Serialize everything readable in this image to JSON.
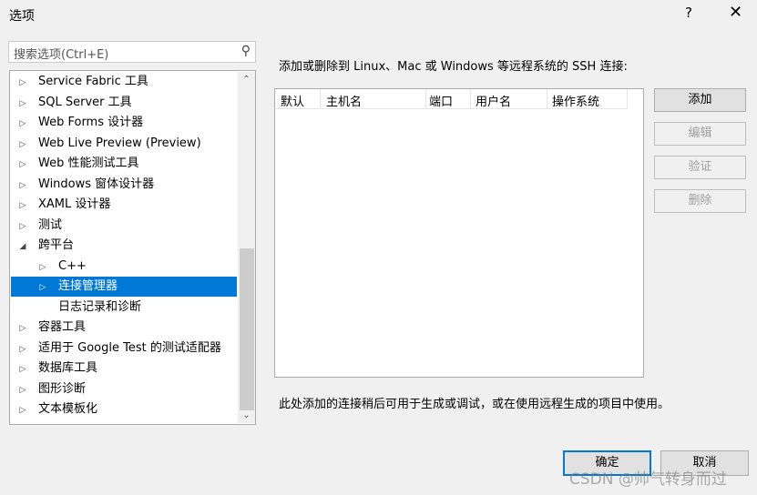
{
  "window": {
    "title": "选项",
    "help": "?",
    "close": "✕"
  },
  "search": {
    "placeholder": "搜索选项(Ctrl+E)"
  },
  "tree": {
    "items": [
      {
        "label": "Service Fabric 工具",
        "level": 0,
        "expander": "collapsed"
      },
      {
        "label": "SQL Server 工具",
        "level": 0,
        "expander": "collapsed"
      },
      {
        "label": "Web Forms 设计器",
        "level": 0,
        "expander": "collapsed"
      },
      {
        "label": "Web Live Preview (Preview)",
        "level": 0,
        "expander": "collapsed"
      },
      {
        "label": "Web 性能测试工具",
        "level": 0,
        "expander": "collapsed"
      },
      {
        "label": "Windows 窗体设计器",
        "level": 0,
        "expander": "collapsed"
      },
      {
        "label": "XAML 设计器",
        "level": 0,
        "expander": "collapsed"
      },
      {
        "label": "测试",
        "level": 0,
        "expander": "collapsed"
      },
      {
        "label": "跨平台",
        "level": 0,
        "expander": "expanded"
      },
      {
        "label": "C++",
        "level": 1,
        "expander": "collapsed"
      },
      {
        "label": "连接管理器",
        "level": 1,
        "expander": "collapsed",
        "selected": true
      },
      {
        "label": "日志记录和诊断",
        "level": 1,
        "expander": "none"
      },
      {
        "label": "容器工具",
        "level": 0,
        "expander": "collapsed"
      },
      {
        "label": "适用于 Google Test 的测试适配器",
        "level": 0,
        "expander": "collapsed"
      },
      {
        "label": "数据库工具",
        "level": 0,
        "expander": "collapsed"
      },
      {
        "label": "图形诊断",
        "level": 0,
        "expander": "collapsed"
      },
      {
        "label": "文本模板化",
        "level": 0,
        "expander": "collapsed"
      }
    ]
  },
  "main": {
    "description": "添加或删除到 Linux、Mac 或 Windows 等远程系统的 SSH 连接:",
    "columns": [
      "默认",
      "主机名",
      "端口",
      "用户名",
      "操作系统"
    ],
    "rows": [],
    "buttons": {
      "add": "添加",
      "edit": "编辑",
      "verify": "验证",
      "delete": "删除"
    },
    "footnote": "此处添加的连接稍后可用于生成或调试，或在使用远程生成的项目中使用。"
  },
  "footer": {
    "ok": "确定",
    "cancel": "取消"
  },
  "watermark": "CSDN @帅气转身而过",
  "colors": {
    "selection": "#0078d7"
  }
}
